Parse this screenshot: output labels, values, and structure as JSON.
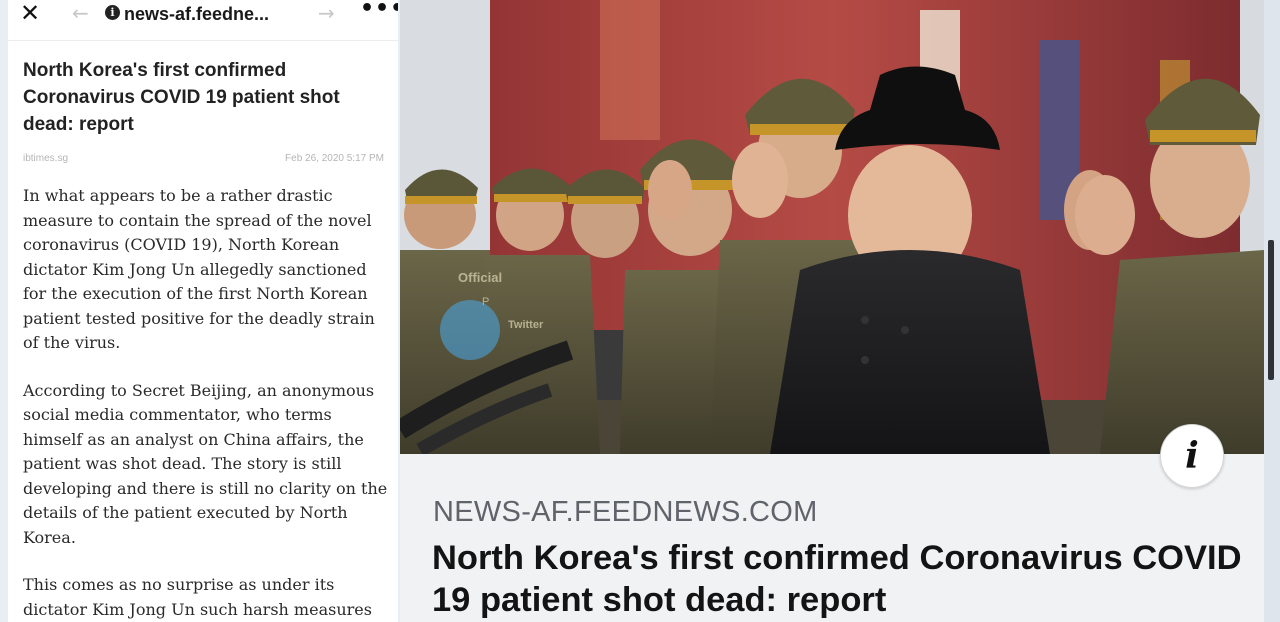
{
  "browser": {
    "close_icon": "close-icon",
    "back_icon": "arrow-left-icon",
    "info_icon": "info-icon",
    "url": "news-af.feedne...",
    "forward_icon": "arrow-right-icon",
    "more_icon": "more-dots-icon"
  },
  "article": {
    "title": "North Korea's first confirmed Coronavirus COVID 19 patient shot dead: report",
    "source": "ibtimes.sg",
    "date": "Feb 26, 2020 5:17 PM",
    "paragraphs": [
      "In what appears to be a rather drastic measure to contain the spread of the novel coronavirus (COVID 19), North Korean dictator Kim Jong Un allegedly sanctioned for the execution of the first North Korean patient tested positive for the deadly strain of the virus.",
      "According to Secret Beijing, an anonymous social media commentator, who terms himself as an analyst on China affairs, the patient was shot dead. The story is still developing and there is still no clarity on the details of the patient executed by North Korea.",
      "This comes as no surprise as under its dictator Kim Jong Un such harsh measures"
    ]
  },
  "preview": {
    "watermark": [
      "Official",
      "P",
      "Twitter"
    ],
    "info_label": "i",
    "domain": "NEWS-AF.FEEDNEWS.COM",
    "title": "North Korea's first confirmed Coronavirus COVID 19 patient shot dead: report"
  },
  "colors": {
    "uniform": "#5e5a3f",
    "cap_band": "#c6952a",
    "background_red": "#b0413e",
    "text_dark": "#222222",
    "domain_gray": "#5f636a"
  }
}
